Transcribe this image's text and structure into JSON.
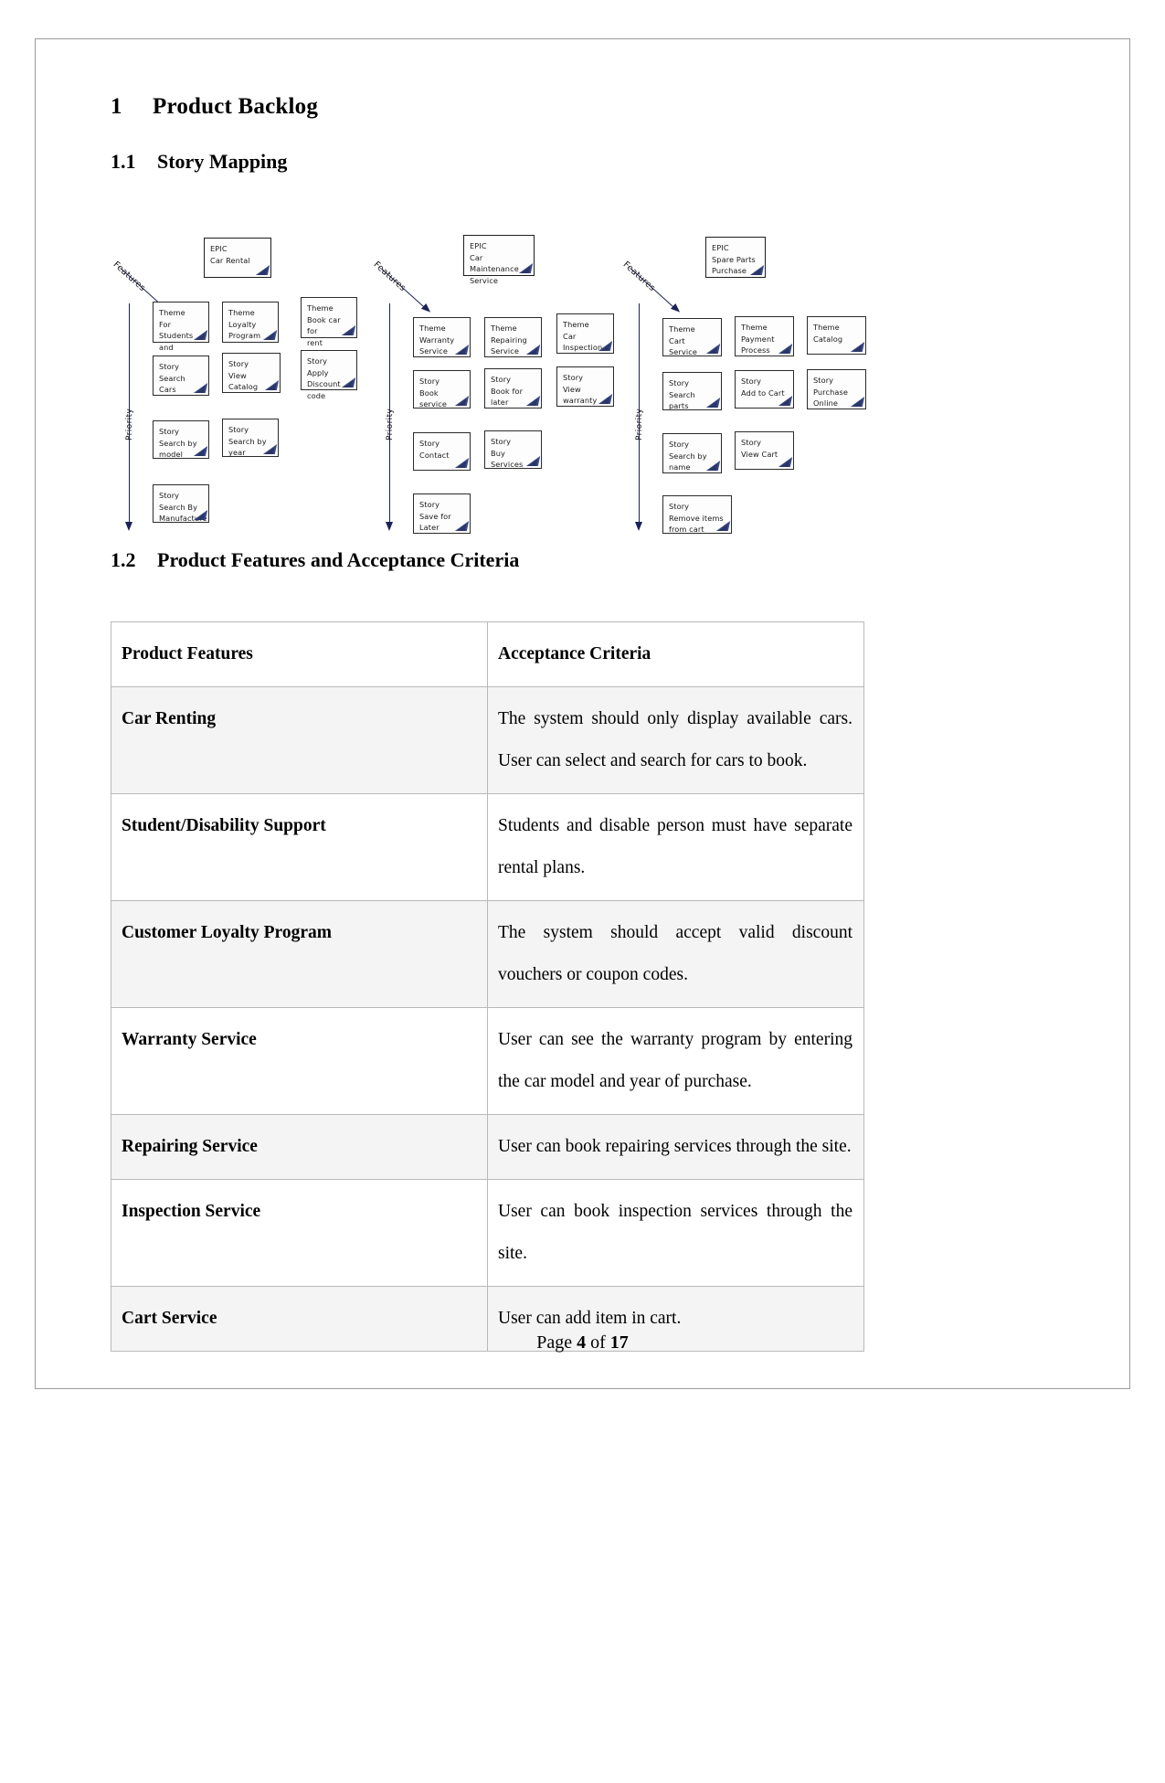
{
  "document": {
    "section1": {
      "number": "1",
      "title": "Product Backlog"
    },
    "section11": {
      "number": "1.1",
      "title": "Story Mapping"
    },
    "section12": {
      "number": "1.2",
      "title": "Product Features and Acceptance Criteria"
    },
    "footer": {
      "prefix": "Page ",
      "page": "4",
      "middle": " of ",
      "total": "17"
    }
  },
  "story_map": {
    "axis_labels": {
      "features": "Features",
      "priority": "Priority"
    },
    "groups": [
      {
        "epic": "EPIC\nCar Rental",
        "cards": [
          "Theme\nFor Students\nand disable",
          "Theme\nLoyalty\nProgram",
          "Theme\nBook car for\nrent",
          "Story\nSearch Cars",
          "Story\nView Catalog",
          "Story\nApply\nDiscount\ncode",
          "Story\nSearch by\nmodel",
          "Story\nSearch by\nyear",
          "Story\nSearch By\nManufacture"
        ]
      },
      {
        "epic": "EPIC\nCar Maintenance\nService",
        "cards": [
          "Theme\nWarranty\nService",
          "Theme\nRepairing\nService",
          "Theme\nCar\nInspection",
          "Story\nBook service",
          "Story\nBook for\nlater",
          "Story\nView\nwarranty",
          "Story\nContact",
          "Story\nBuy Services",
          "Story\nSave for\nLater"
        ]
      },
      {
        "epic": "EPIC\nSpare Parts\nPurchase",
        "cards": [
          "Theme\nCart Service",
          "Theme\nPayment\nProcess",
          "Theme\nCatalog",
          "Story\nSearch parts",
          "Story\nAdd to Cart",
          "Story\nPurchase\nOnline",
          "Story\nSearch by\nname",
          "Story\nView Cart",
          "Story\nRemove items\nfrom cart"
        ]
      }
    ]
  },
  "table": {
    "headers": {
      "col1": "Product Features",
      "col2": "Acceptance Criteria"
    },
    "rows": [
      {
        "feature": "Car Renting",
        "criteria": "The system should only display available cars. User can select and search for cars to book."
      },
      {
        "feature": "Student/Disability Support",
        "criteria": "Students and disable person must have separate rental plans."
      },
      {
        "feature": "Customer Loyalty Program",
        "criteria": "The system should accept valid discount vouchers or coupon codes."
      },
      {
        "feature": "Warranty Service",
        "criteria": "User can see the warranty program by entering the car model and year of purchase."
      },
      {
        "feature": "Repairing Service",
        "criteria": "User can book repairing services through the site."
      },
      {
        "feature": "Inspection Service",
        "criteria": "User can book inspection services through the site."
      },
      {
        "feature": "Cart Service",
        "criteria": "User can add item in cart."
      }
    ]
  }
}
